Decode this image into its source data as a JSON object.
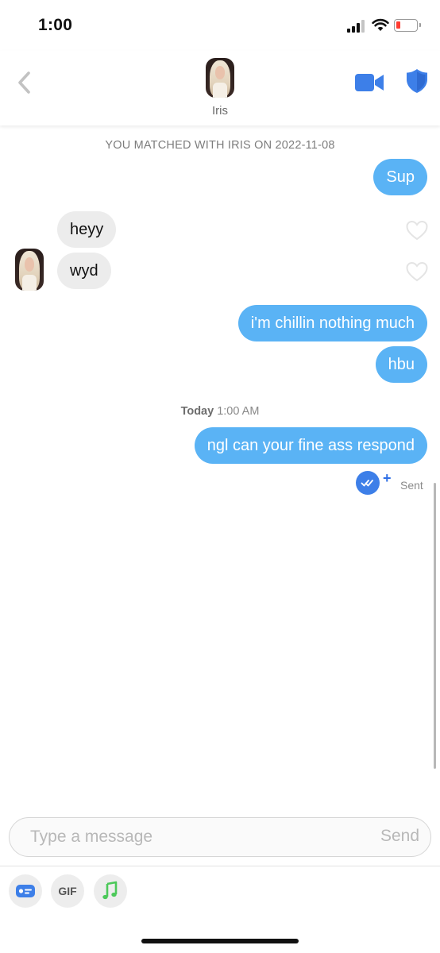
{
  "status_bar": {
    "time": "1:00"
  },
  "header": {
    "contact_name": "Iris"
  },
  "chat": {
    "match_note": "YOU MATCHED WITH IRIS ON 2022-11-08",
    "messages": [
      {
        "text": "Sup",
        "direction": "outgoing"
      },
      {
        "text": "heyy",
        "direction": "incoming"
      },
      {
        "text": "wyd",
        "direction": "incoming"
      },
      {
        "text": "i'm chillin nothing much",
        "direction": "outgoing"
      },
      {
        "text": "hbu",
        "direction": "outgoing"
      },
      {
        "text": "ngl can your fine ass respond",
        "direction": "outgoing"
      }
    ],
    "divider_day": "Today",
    "divider_time": "1:00 AM",
    "receipt_plus": "+",
    "sent_status": "Sent"
  },
  "composer": {
    "placeholder": "Type a message",
    "send_label": "Send"
  },
  "toolbar": {
    "gif_label": "GIF"
  },
  "colors": {
    "accent_blue": "#3d7fe8",
    "outgoing_bubble": "#5ab3f5",
    "incoming_bubble": "#ececec",
    "battery_low": "#ff3b30",
    "music_green": "#4cc95a"
  }
}
